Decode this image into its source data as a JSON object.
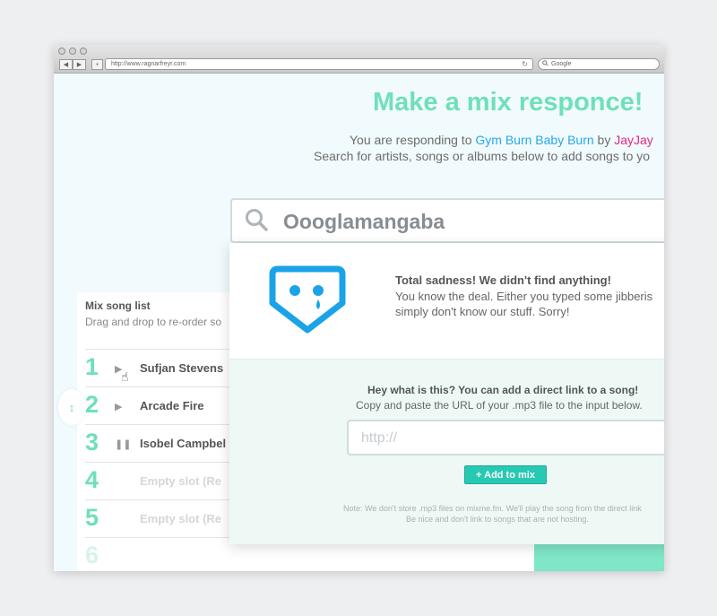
{
  "browser": {
    "url": "http://www.ragnarfreyr.com",
    "search_placeholder": "Google",
    "back_icon": "◀",
    "forward_icon": "▶",
    "add_icon": "+",
    "reload_icon": "↻"
  },
  "page": {
    "title": "Make a mix responce!",
    "responding_prefix": "You are responding to",
    "mix_name": "Gym Burn Baby Burn",
    "by_word": "by",
    "author": "JayJay",
    "instructions": "Search for artists, songs or albums below to add songs to yo"
  },
  "search": {
    "query": "Oooglamangaba"
  },
  "not_found": {
    "title": "Total sadness! We didn't find anything!",
    "line1": "You know the deal. Either you typed some jibberis",
    "line2": "simply don't know our stuff. Sorry!"
  },
  "direct_link": {
    "title": "Hey what is this? You can add a direct link to a song!",
    "subtitle": "Copy and paste the URL of your .mp3 file to the input below.",
    "placeholder": "http://",
    "add_button": "+ Add to mix",
    "note_line1": "Note: We don't store .mp3 files on mixme.fm. We'll play the song from the direct link",
    "note_line2": "Be nice and don't link to songs that are not hosting."
  },
  "mix_list": {
    "title": "Mix song list",
    "subtitle": "Drag and drop to re-order so",
    "handle_icon": "↕",
    "rows": [
      {
        "num": "1",
        "control": "▶",
        "label": "Sufjan Stevens"
      },
      {
        "num": "2",
        "control": "▶",
        "label": "Arcade Fire"
      },
      {
        "num": "3",
        "control": "❚❚",
        "label": "Isobel Campbel"
      },
      {
        "num": "4",
        "control": "",
        "label": "Empty slot (Re"
      },
      {
        "num": "5",
        "control": "",
        "label": "Empty slot (Re"
      },
      {
        "num": "6",
        "control": "",
        "label": ""
      }
    ]
  },
  "colors": {
    "accent_mint": "#6fe0b8",
    "link_blue": "#25a9e6",
    "link_pink": "#e6287f",
    "button_teal": "#27c9b3",
    "sad_icon_blue": "#1aa3e8"
  }
}
